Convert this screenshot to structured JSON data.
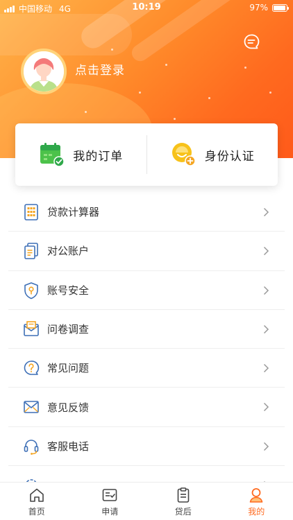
{
  "status_bar": {
    "carrier": "中国移动",
    "network": "4G",
    "time": "10:19",
    "battery": "97%",
    "battery_level": 0.97
  },
  "profile": {
    "login_text": "点击登录",
    "message_icon": "message-icon"
  },
  "quick_actions": [
    {
      "label": "我的订单",
      "icon": "order-calendar-icon",
      "color": "#4cc24a"
    },
    {
      "label": "身份认证",
      "icon": "identity-verify-icon",
      "color": "#f5b400"
    }
  ],
  "menu": [
    {
      "label": "贷款计算器",
      "icon": "calculator-icon"
    },
    {
      "label": "对公账户",
      "icon": "account-icon"
    },
    {
      "label": "账号安全",
      "icon": "shield-icon"
    },
    {
      "label": "问卷调查",
      "icon": "survey-icon"
    },
    {
      "label": "常见问题",
      "icon": "question-icon"
    },
    {
      "label": "意见反馈",
      "icon": "mail-icon"
    },
    {
      "label": "客服电话",
      "icon": "headset-icon"
    }
  ],
  "tabbar": {
    "items": [
      {
        "label": "首页",
        "icon": "home-icon"
      },
      {
        "label": "申请",
        "icon": "apply-icon"
      },
      {
        "label": "贷后",
        "icon": "clipboard-icon"
      },
      {
        "label": "我的",
        "icon": "profile-icon"
      }
    ],
    "active_index": 3
  },
  "colors": {
    "accent": "#ff6a1f",
    "icon_blue": "#3d6fb6",
    "icon_orange": "#f5a623"
  }
}
